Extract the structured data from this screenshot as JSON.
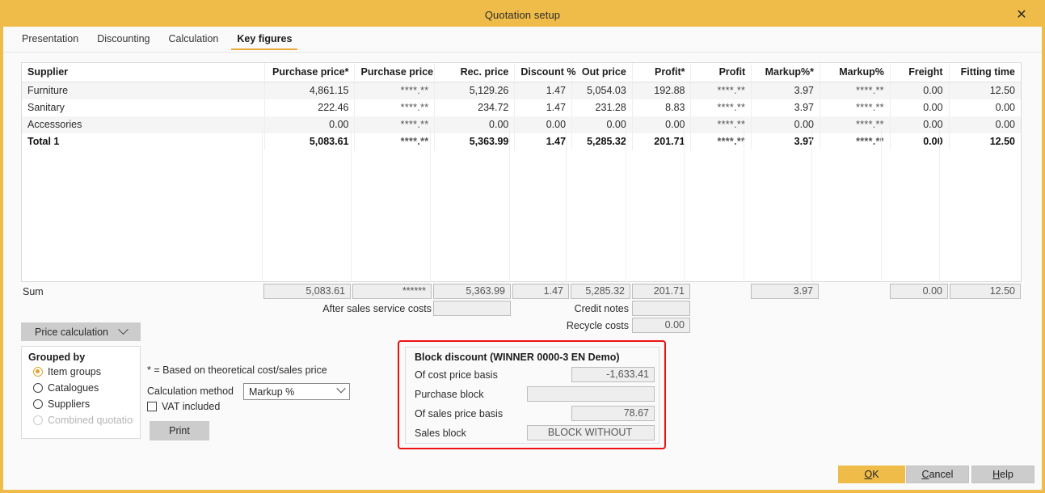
{
  "window": {
    "title": "Quotation setup",
    "close_icon": "close-icon"
  },
  "tabs": [
    {
      "label": "Presentation",
      "active": false
    },
    {
      "label": "Discounting",
      "active": false
    },
    {
      "label": "Calculation",
      "active": false
    },
    {
      "label": "Key figures",
      "active": true
    }
  ],
  "grid": {
    "columns": [
      "Supplier",
      "Purchase price*",
      "Purchase price",
      "Rec. price",
      "Discount %",
      "Out price",
      "Profit*",
      "Profit",
      "Markup%*",
      "Markup%",
      "Freight",
      "Fitting time"
    ],
    "rows": [
      {
        "supplier": "Furniture",
        "values": [
          "4,861.15",
          "****.**",
          "5,129.26",
          "1.47",
          "5,054.03",
          "192.88",
          "****.**",
          "3.97",
          "****.**",
          "0.00",
          "12.50"
        ],
        "total": false
      },
      {
        "supplier": "Sanitary",
        "values": [
          "222.46",
          "****.**",
          "234.72",
          "1.47",
          "231.28",
          "8.83",
          "****.**",
          "3.97",
          "****.**",
          "0.00",
          "0.00"
        ],
        "total": false
      },
      {
        "supplier": "Accessories",
        "values": [
          "0.00",
          "****.**",
          "0.00",
          "0.00",
          "0.00",
          "0.00",
          "****.**",
          "0.00",
          "****.**",
          "0.00",
          "0.00"
        ],
        "total": false
      },
      {
        "supplier": "Total 1",
        "values": [
          "5,083.61",
          "****.**",
          "5,363.99",
          "1.47",
          "5,285.32",
          "201.71",
          "****.**",
          "3.97",
          "****.**",
          "0.00",
          "12.50"
        ],
        "total": true
      }
    ]
  },
  "sum": {
    "label": "Sum",
    "purchase_price_star": "5,083.61",
    "purchase_price": "******",
    "rec_price": "5,363.99",
    "discount_pct": "1.47",
    "out_price": "5,285.32",
    "profit_star": "201.71",
    "markup_pct_star": "3.97",
    "freight": "0.00",
    "fitting_time": "12.50",
    "after_sales_service_costs_label": "After sales service costs",
    "after_sales_service_costs_value": "",
    "credit_notes_label": "Credit notes",
    "credit_notes_value": "",
    "recycle_costs_label": "Recycle costs",
    "recycle_costs_value": "0.00"
  },
  "price_calculation": {
    "button_label": "Price calculation",
    "chevron_icon": "chevron-down-icon"
  },
  "grouped_by": {
    "title": "Grouped by",
    "options": [
      {
        "label": "Item groups",
        "selected": true,
        "disabled": false
      },
      {
        "label": "Catalogues",
        "selected": false,
        "disabled": false
      },
      {
        "label": "Suppliers",
        "selected": false,
        "disabled": false
      },
      {
        "label": "Combined quotation l...",
        "selected": false,
        "disabled": true
      }
    ]
  },
  "options": {
    "footnote": "* = Based on theoretical cost/sales price",
    "calculation_method_label": "Calculation method",
    "calculation_method_value": "Markup %",
    "vat_included_label": "VAT included",
    "vat_included_checked": false,
    "print_label": "Print"
  },
  "block_discount": {
    "title": "Block discount (WINNER 0000-3 EN Demo)",
    "rows": [
      {
        "label": "Of cost price basis",
        "value": "-1,633.41",
        "wide": false
      },
      {
        "label": "Purchase block",
        "value": "",
        "wide": true
      },
      {
        "label": "Of sales price basis",
        "value": "78.67",
        "wide": false
      },
      {
        "label": "Sales block",
        "value": "BLOCK WITHOUT",
        "wide": true
      }
    ]
  },
  "footer": {
    "ok": "OK",
    "cancel": "Cancel",
    "help": "Help"
  },
  "colors": {
    "accent": "#f0bc49",
    "highlight_border": "#ee1111",
    "tab_underline": "#e8a93a"
  }
}
